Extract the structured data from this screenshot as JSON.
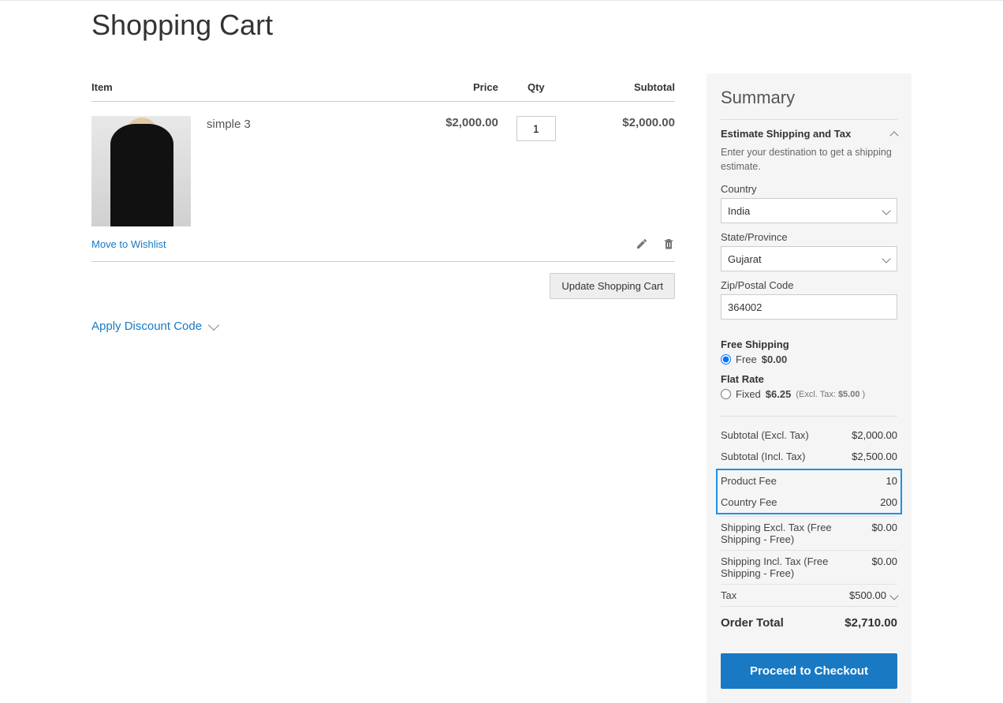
{
  "page": {
    "title": "Shopping Cart"
  },
  "cart": {
    "headers": {
      "item": "Item",
      "price": "Price",
      "qty": "Qty",
      "subtotal": "Subtotal"
    },
    "items": [
      {
        "name": "simple 3",
        "price": "$2,000.00",
        "qty": "1",
        "subtotal": "$2,000.00"
      }
    ],
    "wishlist_label": "Move to Wishlist",
    "update_label": "Update Shopping Cart",
    "discount_label": "Apply Discount Code"
  },
  "summary": {
    "title": "Summary",
    "shipping_header": "Estimate Shipping and Tax",
    "shipping_desc": "Enter your destination to get a shipping estimate.",
    "country_label": "Country",
    "country_value": "India",
    "state_label": "State/Province",
    "state_value": "Gujarat",
    "zip_label": "Zip/Postal Code",
    "zip_value": "364002",
    "methods": {
      "free": {
        "title": "Free Shipping",
        "opt_label": "Free",
        "price": "$0.00"
      },
      "flat": {
        "title": "Flat Rate",
        "opt_label": "Fixed",
        "price": "$6.25",
        "excl_prefix": "(Excl. Tax:",
        "excl_price": "$5.00",
        "excl_suffix": ")"
      }
    },
    "totals": {
      "subtotal_excl": {
        "label": "Subtotal (Excl. Tax)",
        "value": "$2,000.00"
      },
      "subtotal_incl": {
        "label": "Subtotal (Incl. Tax)",
        "value": "$2,500.00"
      },
      "product_fee": {
        "label": "Product Fee",
        "value": "10"
      },
      "country_fee": {
        "label": "Country Fee",
        "value": "200"
      },
      "ship_excl": {
        "label": "Shipping Excl. Tax (Free Shipping - Free)",
        "value": "$0.00"
      },
      "ship_incl": {
        "label": "Shipping Incl. Tax (Free Shipping - Free)",
        "value": "$0.00"
      },
      "tax": {
        "label": "Tax",
        "value": "$500.00"
      },
      "grand": {
        "label": "Order Total",
        "value": "$2,710.00"
      }
    },
    "checkout_label": "Proceed to Checkout"
  }
}
